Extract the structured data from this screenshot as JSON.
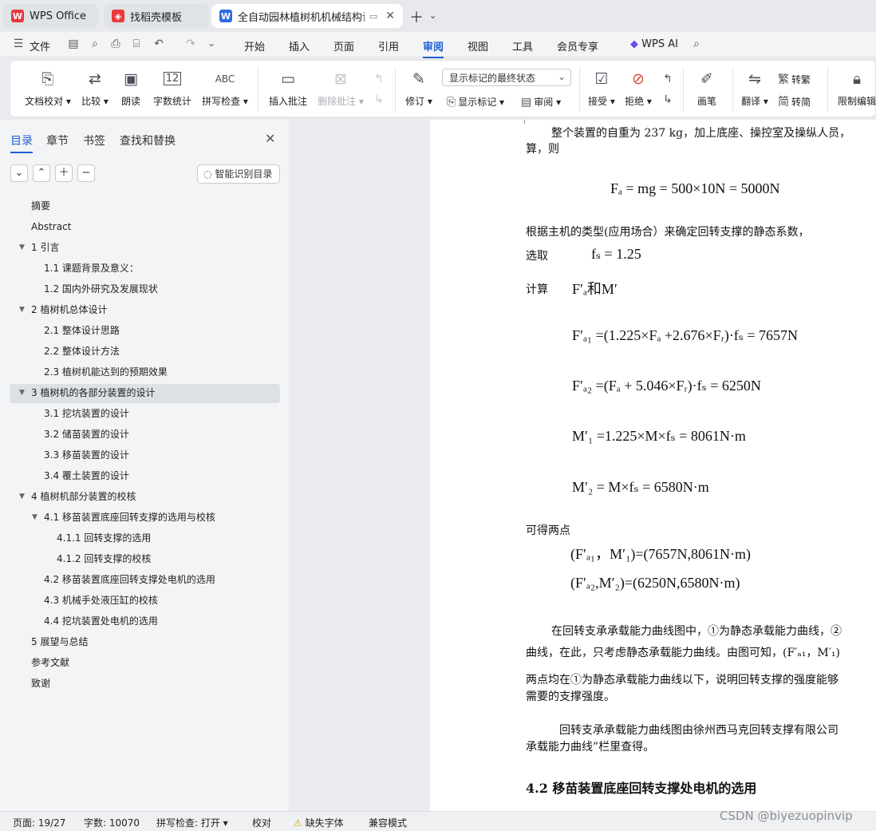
{
  "tabs": [
    {
      "label": "WPS Office",
      "icon": "wps-logo-icon"
    },
    {
      "label": "找稻壳模板",
      "icon": "docer-icon"
    },
    {
      "label": "全自动园林植树机机械结构设计",
      "icon": "writer-doc-icon"
    }
  ],
  "menu": {
    "file_label": "文件",
    "items": [
      "开始",
      "插入",
      "页面",
      "引用",
      "审阅",
      "视图",
      "工具",
      "会员专享"
    ],
    "active": "审阅",
    "ai_label": "WPS AI"
  },
  "ribbon": {
    "doc_check": "文档校对",
    "compare": "比较",
    "read_aloud": "朗读",
    "word_count": "字数统计",
    "spell_check": "拼写检查",
    "insert_comment": "插入批注",
    "delete_comment": "删除批注",
    "track_changes": "修订",
    "markup_state": "显示标记的最终状态",
    "show_markup": "显示标记",
    "review": "审阅",
    "accept": "接受",
    "reject": "拒绝",
    "pen": "画笔",
    "translate": "翻译",
    "to_traditional": "转繁",
    "to_simplified": "转简",
    "restrict_edit": "限制编辑",
    "abc_glyph": "ABC",
    "count_glyph": "12"
  },
  "sidebar": {
    "tabs": [
      "目录",
      "章节",
      "书签",
      "查找和替换"
    ],
    "smart_toc": "智能识别目录",
    "toc": [
      {
        "label": "摘要",
        "level": 0
      },
      {
        "label": "Abstract",
        "level": 0
      },
      {
        "label": "1 引言",
        "level": 0,
        "expanded": true
      },
      {
        "label": "1.1 课题背景及意义：",
        "level": 1
      },
      {
        "label": "1.2 国内外研究及发展现状",
        "level": 1
      },
      {
        "label": "2 植树机总体设计",
        "level": 0,
        "expanded": true
      },
      {
        "label": "2.1 整体设计思路",
        "level": 1
      },
      {
        "label": "2.2 整体设计方法",
        "level": 1
      },
      {
        "label": "2.3 植树机能达到的预期效果",
        "level": 1
      },
      {
        "label": "3 植树机的各部分装置的设计",
        "level": 0,
        "expanded": true,
        "selected": true
      },
      {
        "label": "3.1 挖坑装置的设计",
        "level": 1
      },
      {
        "label": "3.2 储苗装置的设计",
        "level": 1
      },
      {
        "label": "3.3 移苗装置的设计",
        "level": 1
      },
      {
        "label": "3.4 覆土装置的设计",
        "level": 1
      },
      {
        "label": "4 植树机部分装置的校核",
        "level": 0,
        "expanded": true
      },
      {
        "label": "4.1 移苗装置底座回转支撑的选用与校核",
        "level": 1,
        "expanded": true
      },
      {
        "label": "4.1.1 回转支撑的选用",
        "level": 2
      },
      {
        "label": "4.1.2 回转支撑的校核",
        "level": 2
      },
      {
        "label": "4.2 移苗装置底座回转支撑处电机的选用",
        "level": 1
      },
      {
        "label": "4.3 机械手处液压缸的校核",
        "level": 1
      },
      {
        "label": "4.4 挖坑装置处电机的选用",
        "level": 1
      },
      {
        "label": "5 展望与总结",
        "level": 0
      },
      {
        "label": "参考文献",
        "level": 0
      },
      {
        "label": "致谢",
        "level": 0
      }
    ]
  },
  "document": {
    "p1": "整个装置的自重为 237 kg，加上底座、操控室及操纵人员，",
    "p1b": "算，则",
    "eq1": "Fₐ = mg = 500×10N = 5000N",
    "p2": "根据主机的类型(应用场合）来确定回转支撑的静态系数，",
    "p3_lead": "选取",
    "eq_fs": "fₛ = 1.25",
    "p4_lead": "计算",
    "eq_calc": "F′ₐ和M′",
    "eq2": "F′ₐ₁ =(1.225×Fₐ +2.676×Fᵣ)·fₛ = 7657N",
    "eq3": "F′ₐ₂ =(Fₐ + 5.046×Fᵣ)·fₛ = 6250N",
    "eq4": "M′₁ =1.225×M×fₛ = 8061N·m",
    "eq5": "M′₂ = M×fₛ = 6580N·m",
    "p5": "可得两点",
    "pt1": "(F′ₐ₁，M′₁)=(7657N,8061N·m)",
    "pt2": "(F′ₐ₂,M′₂)=(6250N,6580N·m)",
    "p6a": "在回转支承承载能力曲线图中，①为静态承载能力曲线，②",
    "p6b": "曲线，在此，只考虑静态承载能力曲线。由图可知，(F′ₐ₁，M′₁)",
    "p6c": "两点均在①为静态承载能力曲线以下，说明回转支撑的强度能够",
    "p6d": "需要的支撑强度。",
    "p7a": "回转支承承载能力曲线图由徐州西马克回转支撑有限公司",
    "p7b": "承载能力曲线”栏里查得。",
    "heading": "4.2 移苗装置底座回转支撑处电机的选用"
  },
  "status": {
    "page": "页面: 19/27",
    "words": "字数: 10070",
    "spell": "拼写检查: 打开",
    "proof": "校对",
    "missing_font": "缺失字体",
    "compat": "兼容模式"
  },
  "watermark": "CSDN @biyezuopinvip",
  "colors": {
    "accent": "#1f5fd6",
    "wps_red": "#e8393c"
  }
}
